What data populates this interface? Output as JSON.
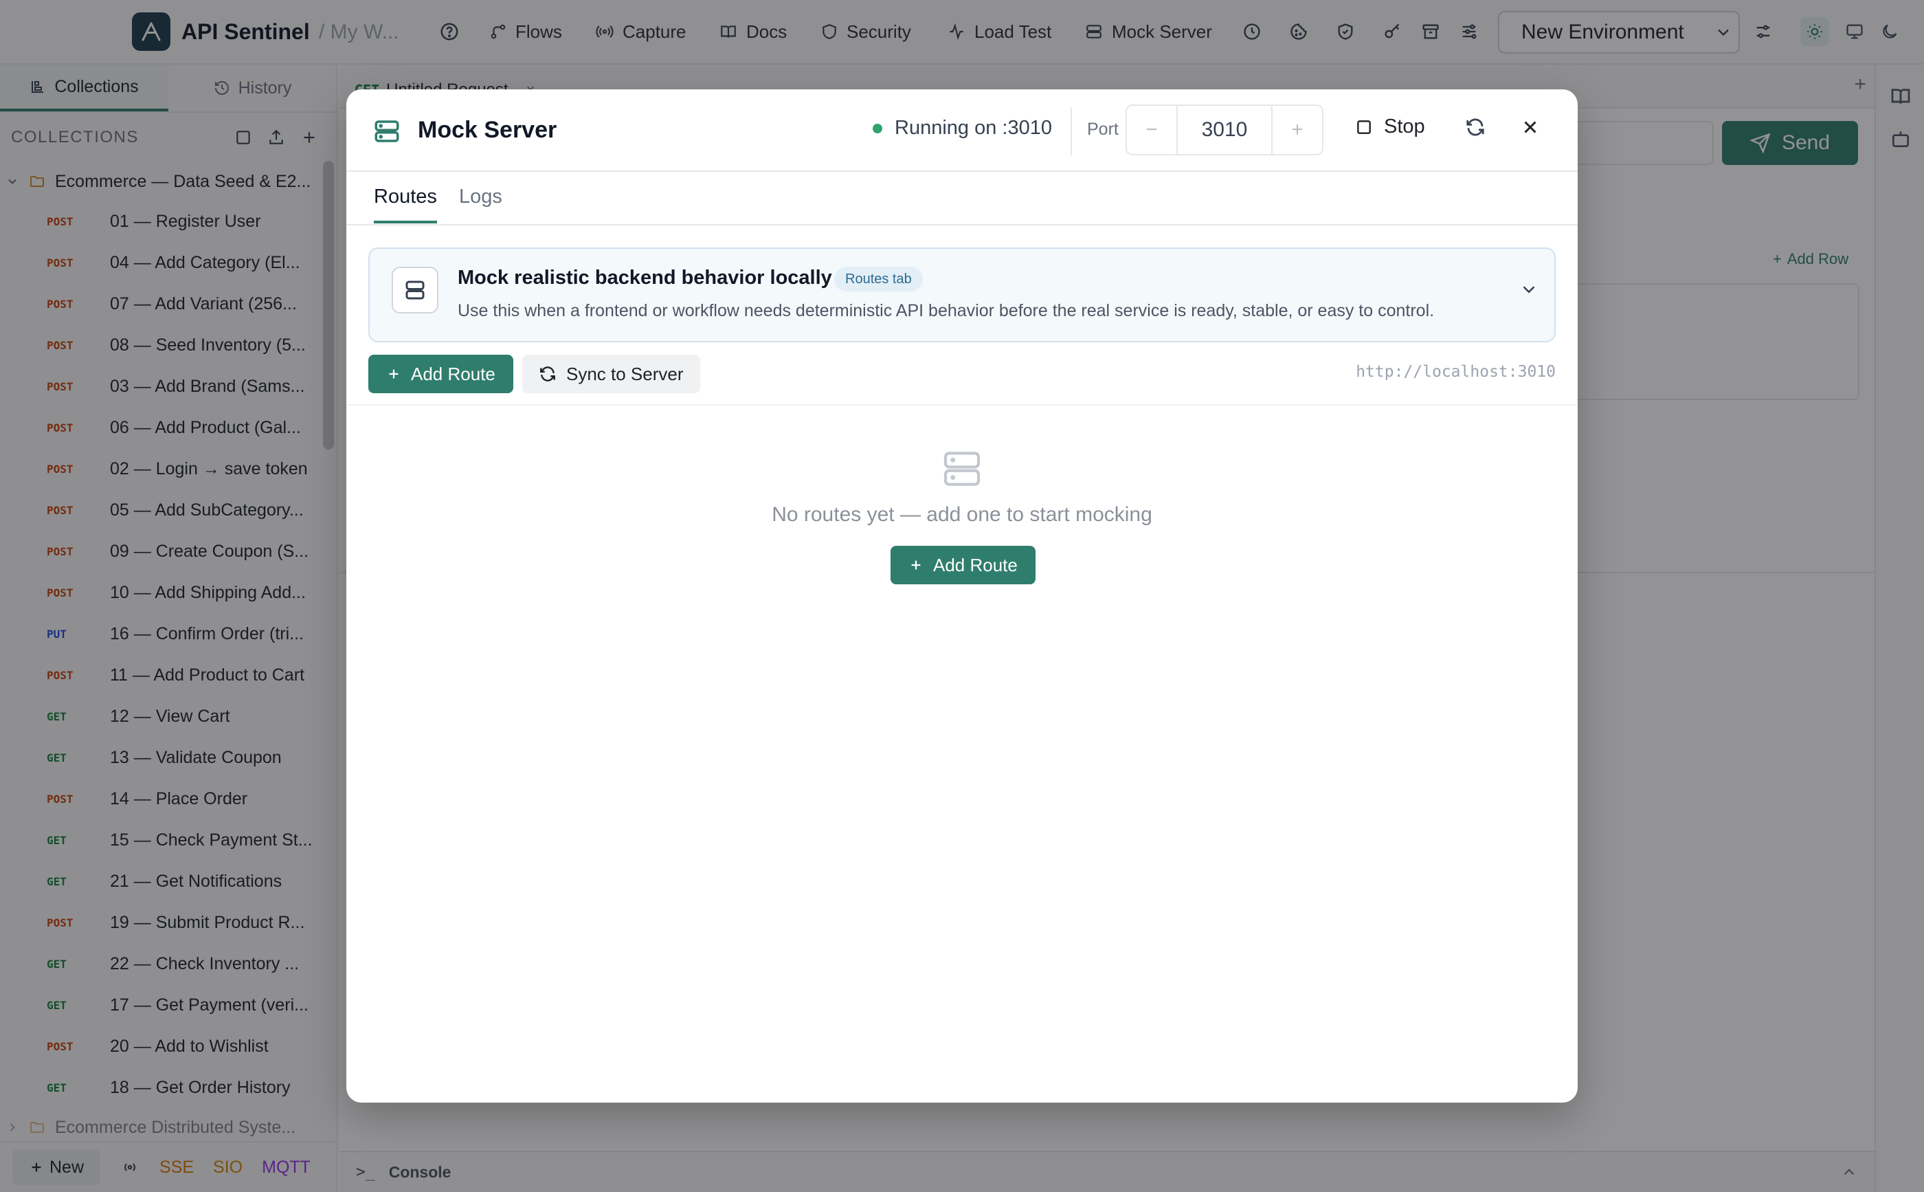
{
  "app": {
    "name": "API Sentinel",
    "workspace": "/ My W..."
  },
  "topnav": {
    "items": [
      {
        "label": "Flows",
        "icon": "flows-icon"
      },
      {
        "label": "Capture",
        "icon": "capture-icon"
      },
      {
        "label": "Docs",
        "icon": "docs-icon"
      },
      {
        "label": "Security",
        "icon": "shield-icon"
      },
      {
        "label": "Load Test",
        "icon": "activity-icon"
      },
      {
        "label": "Mock Server",
        "icon": "server-icon"
      }
    ],
    "environment": "New Environment"
  },
  "sidebar": {
    "tabs": [
      {
        "label": "Collections",
        "active": true
      },
      {
        "label": "History",
        "active": false
      }
    ],
    "section_title": "COLLECTIONS",
    "collections": [
      {
        "name": "Ecommerce — Data Seed & E2...",
        "requests": [
          {
            "method": "POST",
            "name": "01 — Register User"
          },
          {
            "method": "POST",
            "name": "04 — Add Category (El..."
          },
          {
            "method": "POST",
            "name": "07 — Add Variant (256..."
          },
          {
            "method": "POST",
            "name": "08 — Seed Inventory (5..."
          },
          {
            "method": "POST",
            "name": "03 — Add Brand (Sams..."
          },
          {
            "method": "POST",
            "name": "06 — Add Product (Gal..."
          },
          {
            "method": "POST",
            "name": "02 — Login → save token"
          },
          {
            "method": "POST",
            "name": "05 — Add SubCategory..."
          },
          {
            "method": "POST",
            "name": "09 — Create Coupon (S..."
          },
          {
            "method": "POST",
            "name": "10 — Add Shipping Add..."
          },
          {
            "method": "PUT",
            "name": "16 — Confirm Order (tri..."
          },
          {
            "method": "POST",
            "name": "11 — Add Product to Cart"
          },
          {
            "method": "GET",
            "name": "12 — View Cart"
          },
          {
            "method": "GET",
            "name": "13 — Validate Coupon"
          },
          {
            "method": "POST",
            "name": "14 — Place Order"
          },
          {
            "method": "GET",
            "name": "15 — Check Payment St..."
          },
          {
            "method": "GET",
            "name": "21 — Get Notifications"
          },
          {
            "method": "POST",
            "name": "19 — Submit Product R..."
          },
          {
            "method": "GET",
            "name": "22 — Check Inventory ..."
          },
          {
            "method": "GET",
            "name": "17 — Get Payment (veri..."
          },
          {
            "method": "POST",
            "name": "20 — Add to Wishlist"
          },
          {
            "method": "GET",
            "name": "18 — Get Order History"
          }
        ]
      },
      {
        "name": "Ecommerce Distributed Syste..."
      }
    ],
    "bottom": {
      "new_label": "New",
      "protocols": [
        "SSE",
        "SIO",
        "MQTT"
      ]
    }
  },
  "workspace": {
    "request_tab": {
      "method": "GET",
      "name": "Untitled Request"
    },
    "send_label": "Send",
    "add_row_label": "Add Row",
    "console_label": "Console"
  },
  "modal": {
    "title": "Mock Server",
    "status_text": "Running on :3010",
    "port_label": "Port",
    "port_value": "3010",
    "stop_label": "Stop",
    "tabs": [
      {
        "label": "Routes",
        "active": true
      },
      {
        "label": "Logs",
        "active": false
      }
    ],
    "banner": {
      "title": "Mock realistic backend behavior locally",
      "badge": "Routes tab",
      "description": "Use this when a frontend or workflow needs deterministic API behavior before the real service is ready, stable, or easy to control."
    },
    "add_route_label": "Add Route",
    "sync_label": "Sync to Server",
    "base_url": "http://localhost:3010",
    "empty_text": "No routes yet — add one to start mocking"
  },
  "colors": {
    "accent": "#2f7d6d",
    "running": "#2fa36b",
    "post": "#c2410c",
    "get": "#15803d",
    "put": "#1d4ed8"
  }
}
